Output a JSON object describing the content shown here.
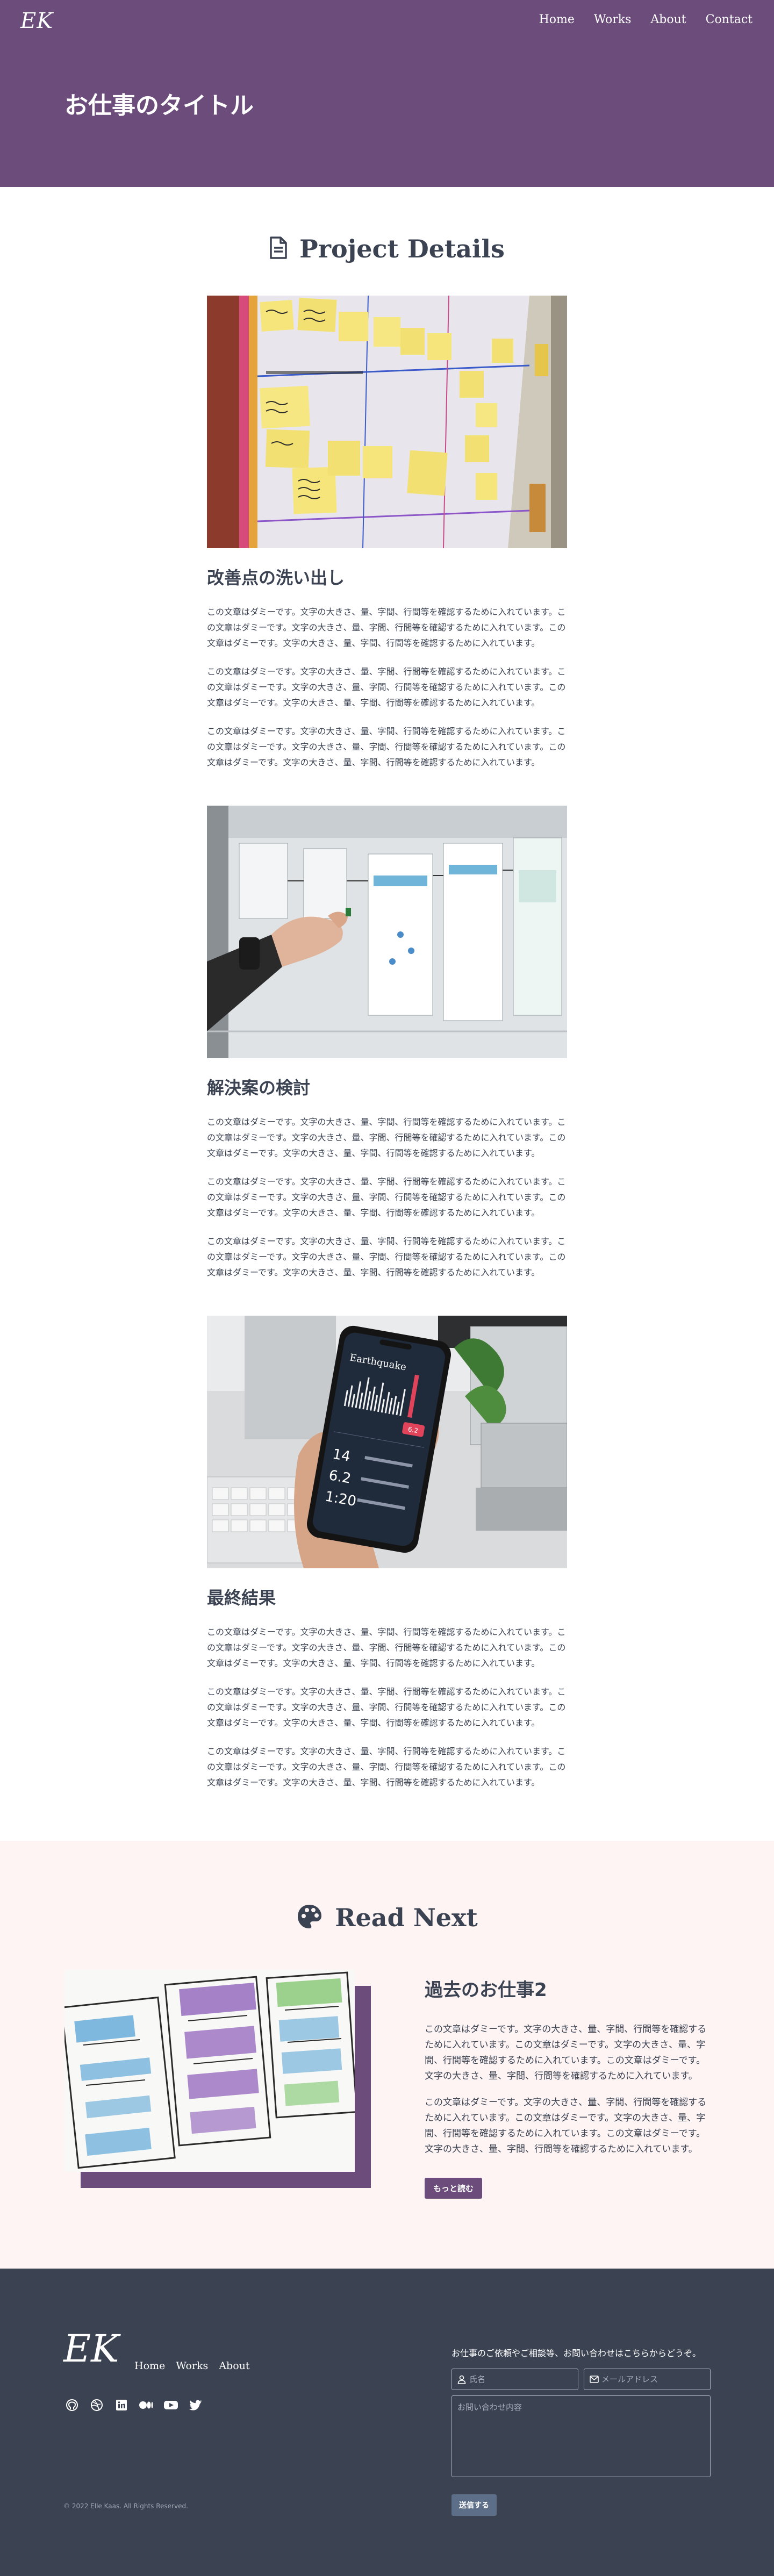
{
  "header": {
    "logo": "EK",
    "nav": [
      "Home",
      "Works",
      "About",
      "Contact"
    ],
    "title": "お仕事のタイトル",
    "bg_color": "#6b4c7b"
  },
  "details": {
    "heading": "Project Details",
    "icon": "file-document-icon",
    "blocks": [
      {
        "photo": "sticky-notes-board-photo",
        "title": "改善点の洗い出し",
        "paragraphs": [
          "この文章はダミーです。文字の大きさ、量、字間、行間等を確認するために入れています。この文章はダミーです。文字の大きさ、量、字間、行間等を確認するために入れています。この文章はダミーです。文字の大きさ、量、字間、行間等を確認するために入れています。",
          "この文章はダミーです。文字の大きさ、量、字間、行間等を確認するために入れています。この文章はダミーです。文字の大きさ、量、字間、行間等を確認するために入れています。この文章はダミーです。文字の大きさ、量、字間、行間等を確認するために入れています。",
          "この文章はダミーです。文字の大きさ、量、字間、行間等を確認するために入れています。この文章はダミーです。文字の大きさ、量、字間、行間等を確認するために入れています。この文章はダミーです。文字の大きさ、量、字間、行間等を確認するために入れています。"
        ]
      },
      {
        "photo": "wireframe-board-photo",
        "title": "解決案の検討",
        "paragraphs": [
          "この文章はダミーです。文字の大きさ、量、字間、行間等を確認するために入れています。この文章はダミーです。文字の大きさ、量、字間、行間等を確認するために入れています。この文章はダミーです。文字の大きさ、量、字間、行間等を確認するために入れています。",
          "この文章はダミーです。文字の大きさ、量、字間、行間等を確認するために入れています。この文章はダミーです。文字の大きさ、量、字間、行間等を確認するために入れています。この文章はダミーです。文字の大きさ、量、字間、行間等を確認するために入れています。",
          "この文章はダミーです。文字の大きさ、量、字間、行間等を確認するために入れています。この文章はダミーです。文字の大きさ、量、字間、行間等を確認するために入れています。この文章はダミーです。文字の大きさ、量、字間、行間等を確認するために入れています。"
        ]
      },
      {
        "photo": "phone-app-photo",
        "title": "最終結果",
        "paragraphs": [
          "この文章はダミーです。文字の大きさ、量、字間、行間等を確認するために入れています。この文章はダミーです。文字の大きさ、量、字間、行間等を確認するために入れています。この文章はダミーです。文字の大きさ、量、字間、行間等を確認するために入れています。",
          "この文章はダミーです。文字の大きさ、量、字間、行間等を確認するために入れています。この文章はダミーです。文字の大きさ、量、字間、行間等を確認するために入れています。この文章はダミーです。文字の大きさ、量、字間、行間等を確認するために入れています。",
          "この文章はダミーです。文字の大きさ、量、字間、行間等を確認するために入れています。この文章はダミーです。文字の大きさ、量、字間、行間等を確認するために入れています。この文章はダミーです。文字の大きさ、量、字間、行間等を確認するために入れています。"
        ]
      }
    ],
    "phone_app": {
      "title": "Earthquake",
      "badge": "6.2",
      "rows": [
        "14",
        "6.2",
        "1:20"
      ]
    }
  },
  "readnext": {
    "heading": "Read Next",
    "icon": "palette-icon",
    "bg_color": "#fdf4f3",
    "title": "過去のお仕事2",
    "paragraphs": [
      "この文章はダミーです。文字の大きさ、量、字間、行間等を確認するために入れています。この文章はダミーです。文字の大きさ、量、字間、行間等を確認するために入れています。この文章はダミーです。文字の大きさ、量、字間、行間等を確認するために入れています。",
      "この文章はダミーです。文字の大きさ、量、字間、行間等を確認するために入れています。この文章はダミーです。文字の大きさ、量、字間、行間等を確認するために入れています。この文章はダミーです。文字の大きさ、量、字間、行間等を確認するために入れています。"
    ],
    "button": "もっと読む"
  },
  "footer": {
    "logo": "EK",
    "nav": [
      "Home",
      "Works",
      "About"
    ],
    "social_icons": [
      "github-icon",
      "dribbble-icon",
      "linkedin-icon",
      "medium-icon",
      "youtube-icon",
      "twitter-icon"
    ],
    "copyright": "© 2022 Elle Kaas. All Rights Reserved.",
    "contact_lead": "お仕事のご依頼やご相談等、お問い合わせはこちらからどうぞ。",
    "name_placeholder": "氏名",
    "email_placeholder": "メールアドレス",
    "message_placeholder": "お問い合わせ内容",
    "send_button": "送信する",
    "bg_color": "#3b4252"
  }
}
